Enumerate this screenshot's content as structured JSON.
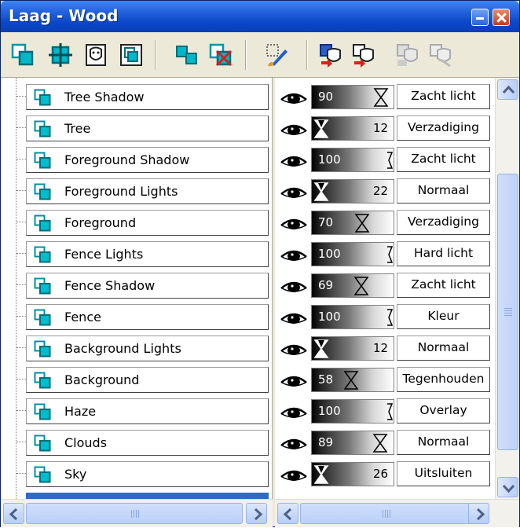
{
  "window": {
    "title": "Laag - Wood"
  },
  "toolbar": {
    "icons": [
      "new-layer-icon",
      "new-adjustment-layer-icon",
      "new-mask-icon",
      "new-group-icon",
      "duplicate-layer-icon",
      "delete-layer-icon",
      "edit-selection-icon",
      "load-mask-icon",
      "save-mask-icon",
      "invert-mask-icon",
      "delete-mask-icon"
    ]
  },
  "layers": [
    {
      "name": "Tree Shadow",
      "opacity": "90",
      "blend": "Zacht licht"
    },
    {
      "name": "Tree",
      "opacity": "12",
      "blend": "Verzadiging"
    },
    {
      "name": "Foreground Shadow",
      "opacity": "100",
      "blend": "Zacht licht"
    },
    {
      "name": "Foreground Lights",
      "opacity": "22",
      "blend": "Normaal"
    },
    {
      "name": "Foreground",
      "opacity": "70",
      "blend": "Verzadiging"
    },
    {
      "name": "Fence Lights",
      "opacity": "100",
      "blend": "Hard licht"
    },
    {
      "name": "Fence Shadow",
      "opacity": "69",
      "blend": "Zacht licht"
    },
    {
      "name": "Fence",
      "opacity": "100",
      "blend": "Kleur"
    },
    {
      "name": "Background Lights",
      "opacity": "12",
      "blend": "Normaal"
    },
    {
      "name": "Background",
      "opacity": "58",
      "blend": "Tegenhouden"
    },
    {
      "name": "Haze",
      "opacity": "100",
      "blend": "Overlay"
    },
    {
      "name": "Clouds",
      "opacity": "89",
      "blend": "Normaal"
    },
    {
      "name": "Sky",
      "opacity": "26",
      "blend": "Uitsluiten"
    }
  ],
  "colors": {
    "titlebar": "#0a47c9",
    "layer_icon": "#00a8b8",
    "scroll": "#b6cdf7"
  }
}
